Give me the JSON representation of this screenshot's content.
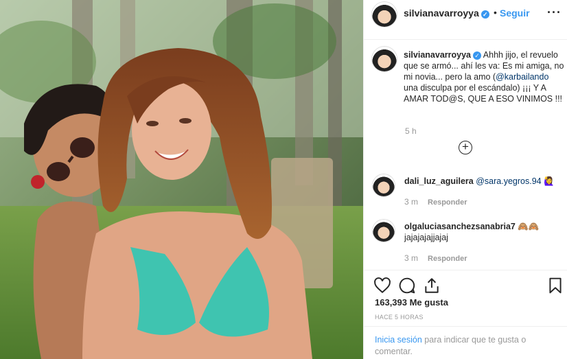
{
  "header": {
    "username": "silvianavarroyya",
    "separator": "•",
    "follow_label": "Seguir",
    "more_label": "···"
  },
  "caption": {
    "username": "silvianavarroyya",
    "text_before": " Ahhh jijo, el revuelo que se armó... ahí les va: Es mi amiga, no mi novia... pero la amo (",
    "mention": "@karbailando",
    "text_after": " una disculpa por el escándalo) ¡¡¡ Y A AMAR TOD@S, QUE A ESO VINIMOS !!!",
    "timestamp": "5 h"
  },
  "load_more_label": "+",
  "comments": [
    {
      "username": "dali_luz_aguilera",
      "mention": "@sara.yegros.94",
      "text": " 🙋‍♀️",
      "time": "3 m",
      "reply_label": "Responder"
    },
    {
      "username": "olgaluciasanchezsanabria7",
      "mention": "",
      "text": " 🙈🙈 jajajajajjajaj",
      "time": "3 m",
      "reply_label": "Responder"
    }
  ],
  "icons": [
    "heart-icon",
    "comment-icon",
    "share-icon",
    "bookmark-icon",
    "verified-icon",
    "plus-circle-icon"
  ],
  "likes": "163,393 Me gusta",
  "posted_ago": "HACE 5 HORAS",
  "login": {
    "link_label": "Inicia sesión",
    "text": " para indicar que te gusta o comentar."
  },
  "colors": {
    "accent": "#3897f0",
    "swimsuit": "#3fc4b0"
  }
}
